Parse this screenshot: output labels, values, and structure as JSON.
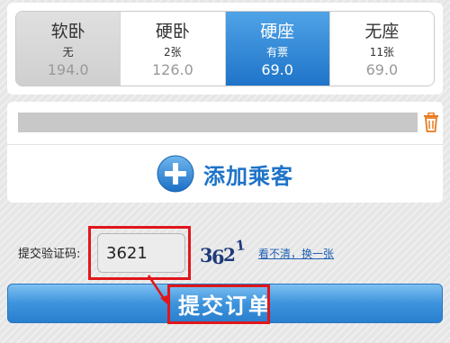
{
  "seats": [
    {
      "name": "软卧",
      "availability": "无",
      "price": "194.0",
      "state": "disabled"
    },
    {
      "name": "硬卧",
      "availability": "2张",
      "price": "126.0",
      "state": "normal"
    },
    {
      "name": "硬座",
      "availability": "有票",
      "price": "69.0",
      "state": "selected"
    },
    {
      "name": "无座",
      "availability": "11张",
      "price": "69.0",
      "state": "normal"
    }
  ],
  "passenger": {
    "add_label": "添加乘客",
    "trash_icon": "trash-icon",
    "add_icon": "plus-circle-icon"
  },
  "captcha": {
    "label": "提交验证码:",
    "value": "3621",
    "image_text": "3621",
    "refresh_link": "看不清，换一张"
  },
  "submit": {
    "label": "提交订单"
  },
  "colors": {
    "accent": "#1d73c8",
    "selected_seat": "#2f86d6",
    "highlight_box": "#e0161a",
    "trash": "#e8791f"
  }
}
